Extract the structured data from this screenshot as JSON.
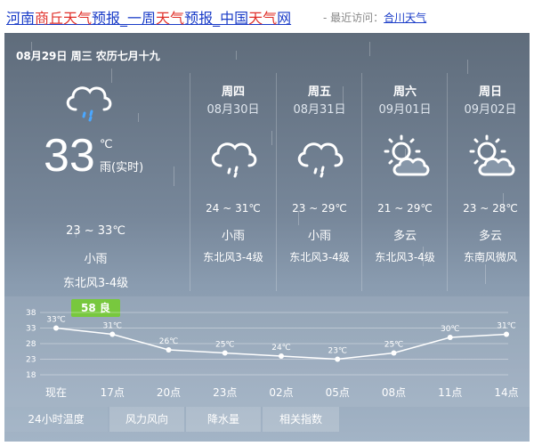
{
  "header": {
    "link_part1": "河南",
    "link_part2": "商丘天气",
    "link_part3": "预报_一周",
    "link_part4": "天气",
    "link_part5": "预报_中国",
    "link_part6": "天气",
    "link_part7": "网",
    "recent_label": "- 最近访问：",
    "recent_link": "合川天气"
  },
  "today": {
    "date_line": "08月29日 周三 农历七月十九",
    "temp": "33",
    "unit": "℃",
    "desc_now": "雨(实时)",
    "range": "23 ~ 33℃",
    "weather": "小雨",
    "wind": "东北风3-4级",
    "aqi": "58 良",
    "icon": "cloud-rain-icon"
  },
  "forecast": [
    {
      "day": "周四",
      "date": "08月30日",
      "range": "24 ~ 31℃",
      "weather": "小雨",
      "wind": "东北风3-4级",
      "icon": "cloud-rain-icon"
    },
    {
      "day": "周五",
      "date": "08月31日",
      "range": "23 ~ 29℃",
      "weather": "小雨",
      "wind": "东北风3-4级",
      "icon": "cloud-rain-icon"
    },
    {
      "day": "周六",
      "date": "09月01日",
      "range": "21 ~ 29℃",
      "weather": "多云",
      "wind": "东北风3-4级",
      "icon": "sun-cloud-icon"
    },
    {
      "day": "周日",
      "date": "09月02日",
      "range": "23 ~ 28℃",
      "weather": "多云",
      "wind": "东南风微风",
      "icon": "sun-cloud-icon"
    }
  ],
  "chart_data": {
    "type": "line",
    "categories": [
      "现在",
      "17点",
      "20点",
      "23点",
      "02点",
      "05点",
      "08点",
      "11点",
      "14点"
    ],
    "values": [
      33,
      31,
      26,
      25,
      24,
      23,
      25,
      30,
      31
    ],
    "point_labels": [
      "33℃",
      "31℃",
      "26℃",
      "25℃",
      "24℃",
      "23℃",
      "25℃",
      "30℃",
      "31℃"
    ],
    "yticks": [
      38,
      33,
      28,
      23,
      18
    ],
    "ylim": [
      18,
      38
    ],
    "grid": true
  },
  "tabs": [
    "24小时温度",
    "风力风向",
    "降水量",
    "相关指数"
  ],
  "colors": {
    "accent": "#6dc42e",
    "link": "#1a3cc8",
    "link_red": "#e0302a"
  }
}
